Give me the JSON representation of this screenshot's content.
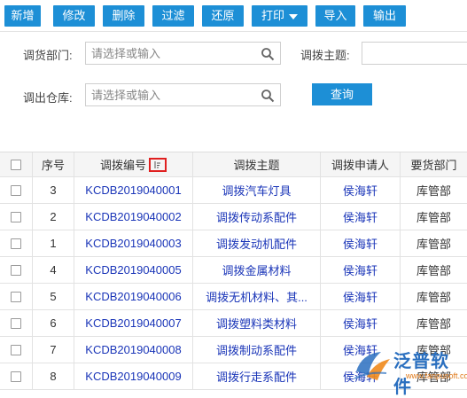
{
  "toolbar": {
    "add": "新增",
    "edit": "修改",
    "delete": "删除",
    "filter": "过滤",
    "restore": "还原",
    "print": "打印",
    "import": "导入",
    "export": "输出"
  },
  "search": {
    "dept_label": "调货部门:",
    "dept_placeholder": "请选择或输入",
    "subject_label": "调拨主题:",
    "subject_value": "",
    "warehouse_label": "调出仓库:",
    "warehouse_placeholder": "请选择或输入",
    "query_label": "查询"
  },
  "table": {
    "headers": {
      "seq": "序号",
      "code": "调拨编号",
      "subject": "调拨主题",
      "applicant": "调拨申请人",
      "dept": "要货部门"
    },
    "rows": [
      {
        "seq": "3",
        "code": "KCDB2019040001",
        "subject": "调拨汽车灯具",
        "applicant": "侯海轩",
        "dept": "库管部"
      },
      {
        "seq": "2",
        "code": "KCDB2019040002",
        "subject": "调拨传动系配件",
        "applicant": "侯海轩",
        "dept": "库管部"
      },
      {
        "seq": "1",
        "code": "KCDB2019040003",
        "subject": "调拨发动机配件",
        "applicant": "侯海轩",
        "dept": "库管部"
      },
      {
        "seq": "4",
        "code": "KCDB2019040005",
        "subject": "调拨金属材料",
        "applicant": "侯海轩",
        "dept": "库管部"
      },
      {
        "seq": "5",
        "code": "KCDB2019040006",
        "subject": "调拨无机材料、其...",
        "applicant": "侯海轩",
        "dept": "库管部"
      },
      {
        "seq": "6",
        "code": "KCDB2019040007",
        "subject": "调拨塑料类材料",
        "applicant": "侯海轩",
        "dept": "库管部"
      },
      {
        "seq": "7",
        "code": "KCDB2019040008",
        "subject": "调拨制动系配件",
        "applicant": "侯海轩",
        "dept": "库管部"
      },
      {
        "seq": "8",
        "code": "KCDB2019040009",
        "subject": "调拨行走系配件",
        "applicant": "侯海轩",
        "dept": "库管部"
      }
    ]
  },
  "watermark": {
    "brand": "泛普软件",
    "url": "www.fanpusoft.com"
  },
  "colors": {
    "accent": "#1d8fd6",
    "link": "#1a35b8",
    "sort_highlight": "#e02020"
  },
  "icons": {
    "field_search": "magnifier-icon",
    "print_dropdown": "caret-down-icon",
    "sort": "sort-icon"
  }
}
